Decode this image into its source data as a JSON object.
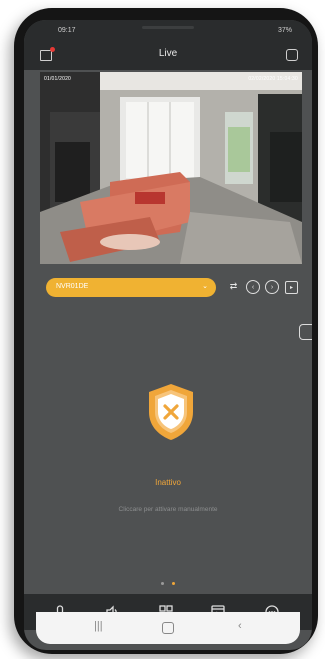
{
  "status_bar": {
    "time": "09:17",
    "battery": "37%"
  },
  "app_bar": {
    "title": "Live"
  },
  "camera": {
    "label_left": "01/01/2020",
    "label_right": "02/02/2020 15:04:30"
  },
  "toolbar": {
    "selected_camera": "NVR01DE",
    "chevron": "⌄"
  },
  "status": {
    "title": "Inattivo",
    "subtitle": "Cliccare per attivare manualmente"
  },
  "pager": {
    "count": 2,
    "active_index": 1
  },
  "colors": {
    "accent": "#f0b232",
    "bar": "#2a2c2d",
    "panel": "#4f5152",
    "status_orange": "#f0a63a"
  },
  "icons": [
    "camera-settings-icon",
    "multi-view-icon",
    "microphone-icon",
    "speaker-icon",
    "grid-icon",
    "playback-icon",
    "more-icon",
    "shield-x-icon"
  ]
}
